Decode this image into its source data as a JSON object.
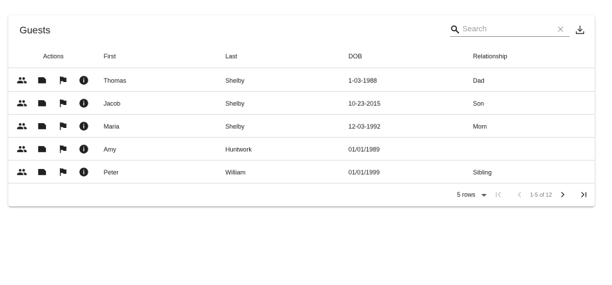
{
  "table": {
    "title": "Guests",
    "search": {
      "placeholder": "Search",
      "value": ""
    },
    "columns": {
      "actions": "Actions",
      "first": "First",
      "last": "Last",
      "dob": "DOB",
      "relationship": "Relationship"
    },
    "rows": [
      {
        "first": "Thomas",
        "last": "Shelby",
        "dob": "1-03-1988",
        "relationship": "Dad"
      },
      {
        "first": "Jacob",
        "last": "Shelby",
        "dob": "10-23-2015",
        "relationship": "Son"
      },
      {
        "first": "Maria",
        "last": "Shelby",
        "dob": "12-03-1992",
        "relationship": "Mom"
      },
      {
        "first": "Amy",
        "last": "Huntwork",
        "dob": "01/01/1989",
        "relationship": ""
      },
      {
        "first": "Peter",
        "last": "William",
        "dob": "01/01/1999",
        "relationship": "Sibling"
      }
    ],
    "row_actions": [
      "group-icon",
      "label-icon",
      "flag-icon",
      "info-icon"
    ],
    "pagination": {
      "rows_per_page": "5 rows",
      "page_info": "1-5 of 12"
    }
  },
  "colors": {
    "text": "#212121",
    "muted": "#9e9e9e",
    "divider": "#e0e0e0",
    "disabled_icon": "#bdbdbd"
  }
}
